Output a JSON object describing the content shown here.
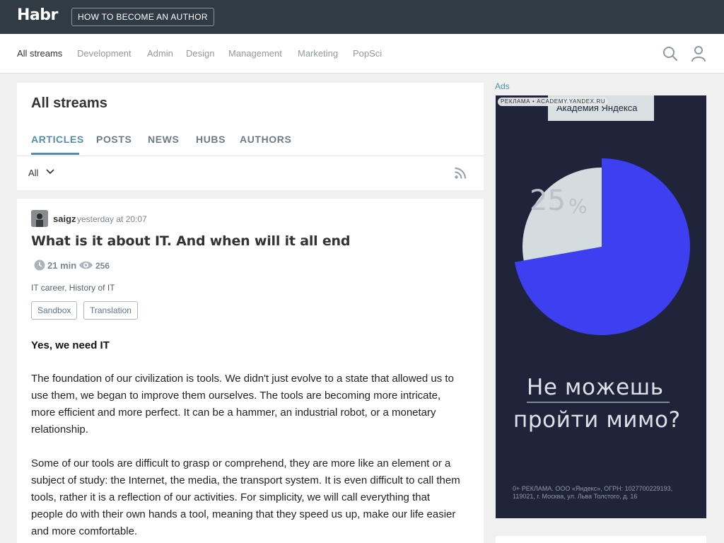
{
  "header": {
    "logo": "Habr",
    "author_button": "HOW TO BECOME AN AUTHOR"
  },
  "nav": {
    "items": [
      {
        "label": "All streams",
        "active": true
      },
      {
        "label": "Development"
      },
      {
        "label": "Admin"
      },
      {
        "label": "Design"
      },
      {
        "label": "Management"
      },
      {
        "label": "Marketing"
      },
      {
        "label": "PopSci"
      }
    ],
    "search_icon": "search-icon",
    "user_icon": "user-icon"
  },
  "stream": {
    "title": "All streams",
    "tabs": [
      {
        "label": "ARTICLES",
        "active": true
      },
      {
        "label": "POSTS"
      },
      {
        "label": "NEWS"
      },
      {
        "label": "HUBS"
      },
      {
        "label": "AUTHORS"
      }
    ],
    "filter": "All",
    "rss_icon": "rss-icon"
  },
  "article": {
    "author": "saigz",
    "time": "yesterday at 20:07",
    "title": "What is it about IT. And when will it all end",
    "read_time": "21 min",
    "views": "256",
    "hubs": "IT career, History of IT",
    "labels": [
      "Sandbox",
      "Translation"
    ],
    "subheading": "Yes, we need IT",
    "paragraphs": [
      [
        "The foundation of our civilization is tools. We didn't just evolve to a state that allowed us to",
        "use them, we began to improve them ourselves. The tools are becoming more intricate,",
        "more efficient and more perfect. It can be a hammer, an industrial robot, or a monetary",
        "relationship."
      ],
      [
        "Some of our tools are difficult to grasp or comprehend, they are more like an element or a",
        "subject of study: the Internet, the media, the transport system. It is even difficult to call them",
        "tools, rather it is a reflection of our activities. For simplicity, we will call everything that",
        "people do with their own hands a tool, meaning that they speed us up, make our life easier",
        "and more comfortable."
      ]
    ]
  },
  "sidebar": {
    "ads_label": "Ads",
    "ad": {
      "tag": "РЕКЛАМА • ACADEMY.YANDEX.RU",
      "brand": "Академия Яндекса",
      "percent_value": "25",
      "percent_sign": "%",
      "pie_fraction": 0.25,
      "headline_line1": "Не можешь",
      "headline_line2": "пройти мимо?",
      "legal_line1": "0+ РЕКЛАМА. ООО «Яндекс», ОГРН: 1027700229193,",
      "legal_line2": "119021, г. Москва, ул. Льва Толстого, д. 16",
      "colors": {
        "background": "#1f243a",
        "main_slice": "#3d3ff0",
        "small_slice": "#d3dcde"
      }
    }
  }
}
